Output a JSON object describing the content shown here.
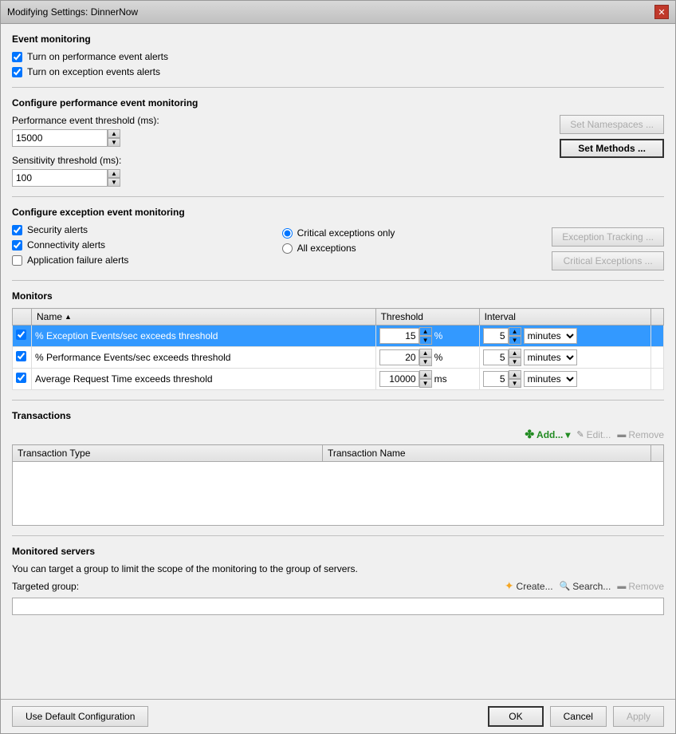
{
  "window": {
    "title": "Modifying Settings: DinnerNow"
  },
  "event_monitoring": {
    "section_title": "Event monitoring",
    "checkbox1_label": "Turn on performance event alerts",
    "checkbox2_label": "Turn on exception events alerts",
    "checkbox1_checked": true,
    "checkbox2_checked": true
  },
  "perf_monitoring": {
    "section_title": "Configure performance event monitoring",
    "threshold_label": "Performance event threshold (ms):",
    "threshold_value": "15000",
    "sensitivity_label": "Sensitivity threshold (ms):",
    "sensitivity_value": "100",
    "btn_namespaces": "Set Namespaces ...",
    "btn_methods": "Set Methods ..."
  },
  "exception_monitoring": {
    "section_title": "Configure exception event monitoring",
    "checkbox1_label": "Security alerts",
    "checkbox1_checked": true,
    "checkbox2_label": "Connectivity alerts",
    "checkbox2_checked": true,
    "checkbox3_label": "Application failure alerts",
    "checkbox3_checked": false,
    "radio1_label": "Critical exceptions only",
    "radio2_label": "All exceptions",
    "radio1_selected": true,
    "btn_exception_tracking": "Exception Tracking ...",
    "btn_critical_exceptions": "Critical Exceptions ..."
  },
  "monitors": {
    "section_title": "Monitors",
    "columns": [
      "Name",
      "Threshold",
      "Interval"
    ],
    "rows": [
      {
        "checked": true,
        "name": "% Exception Events/sec exceeds threshold",
        "threshold_value": "15",
        "threshold_unit": "%",
        "interval_value": "5",
        "interval_unit": "minutes",
        "selected": true
      },
      {
        "checked": true,
        "name": "% Performance Events/sec exceeds threshold",
        "threshold_value": "20",
        "threshold_unit": "%",
        "interval_value": "5",
        "interval_unit": "minutes",
        "selected": false
      },
      {
        "checked": true,
        "name": "Average Request Time exceeds threshold",
        "threshold_value": "10000",
        "threshold_unit": "ms",
        "interval_value": "5",
        "interval_unit": "minutes",
        "selected": false
      }
    ]
  },
  "transactions": {
    "section_title": "Transactions",
    "btn_add": "Add...",
    "btn_edit": "Edit...",
    "btn_remove": "Remove",
    "columns": [
      "Transaction Type",
      "Transaction Name"
    ]
  },
  "monitored_servers": {
    "section_title": "Monitored servers",
    "description": "You can target a group to limit the scope of the monitoring to the group of servers.",
    "targeted_group_label": "Targeted group:",
    "btn_create": "Create...",
    "btn_search": "Search...",
    "btn_remove": "Remove"
  },
  "bottom_bar": {
    "btn_default": "Use Default Configuration",
    "btn_ok": "OK",
    "btn_cancel": "Cancel",
    "btn_apply": "Apply"
  }
}
